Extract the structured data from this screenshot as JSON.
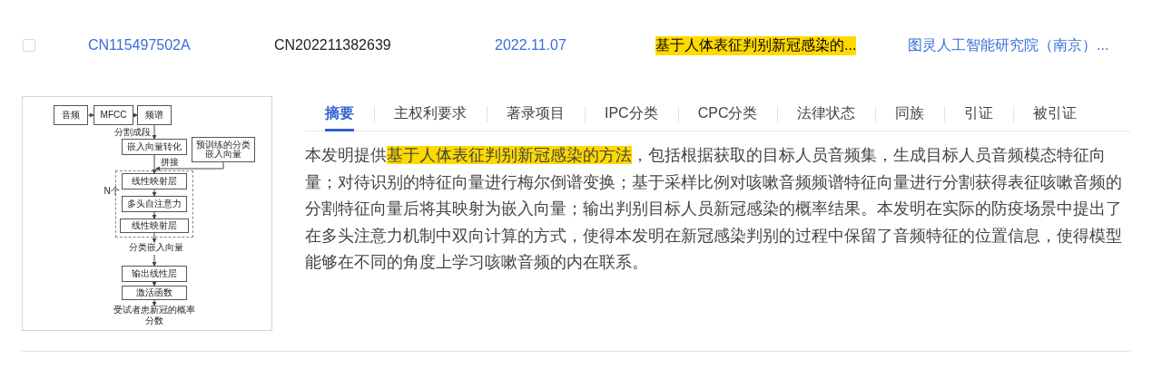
{
  "record": {
    "checked": false,
    "publication_number": "CN115497502A",
    "application_number": "CN202211382639",
    "date": "2022.11.07",
    "title": "基于人体表征判别新冠感染的...",
    "title_highlighted": true,
    "applicant": "图灵人工智能研究院（南京）..."
  },
  "figure": {
    "nodes": [
      {
        "text": "音频"
      },
      {
        "text": "MFCC"
      },
      {
        "text": "频谱"
      },
      {
        "text": "嵌入向量转化"
      },
      {
        "text": "预训练的分类嵌入向量"
      },
      {
        "text": "线性映射层"
      },
      {
        "text": "多头自注意力"
      },
      {
        "text": "线性映射层"
      },
      {
        "text": "输出线性层"
      },
      {
        "text": "激活函数"
      }
    ],
    "labels": [
      "分割成段",
      "拼接",
      "N个",
      "分类嵌入向量",
      "受试者患新冠的概率分数"
    ]
  },
  "tabs": [
    {
      "label": "摘要",
      "selected": true
    },
    {
      "label": "主权利要求",
      "selected": false
    },
    {
      "label": "著录项目",
      "selected": false
    },
    {
      "label": "IPC分类",
      "selected": false
    },
    {
      "label": "CPC分类",
      "selected": false
    },
    {
      "label": "法律状态",
      "selected": false
    },
    {
      "label": "同族",
      "selected": false
    },
    {
      "label": "引证",
      "selected": false
    },
    {
      "label": "被引证",
      "selected": false
    }
  ],
  "abstract": [
    {
      "text": "本发明提供",
      "highlighted": false
    },
    {
      "text": "基于人体表征判别新冠感染的方法",
      "highlighted": true
    },
    {
      "text": "，包括根据获取的目标人员音频集，生成目标人员音频模态特征向量；对待识别的特征向量进行梅尔倒谱变换；基于采样比例对咳嗽音频频谱特征向量进行分割获得表征咳嗽音频的分割特征向量后将其映射为嵌入向量；输出判别目标人员新冠感染的概率结果。本发明在实际的防疫场景中提出了在多头注意力机制中双向计算的方式，使得本发明在新冠感染判别的过程中保留了音频特征的位置信息，使得模型能够在不同的角度上学习咳嗽音频的内在联系。",
      "highlighted": false
    }
  ]
}
